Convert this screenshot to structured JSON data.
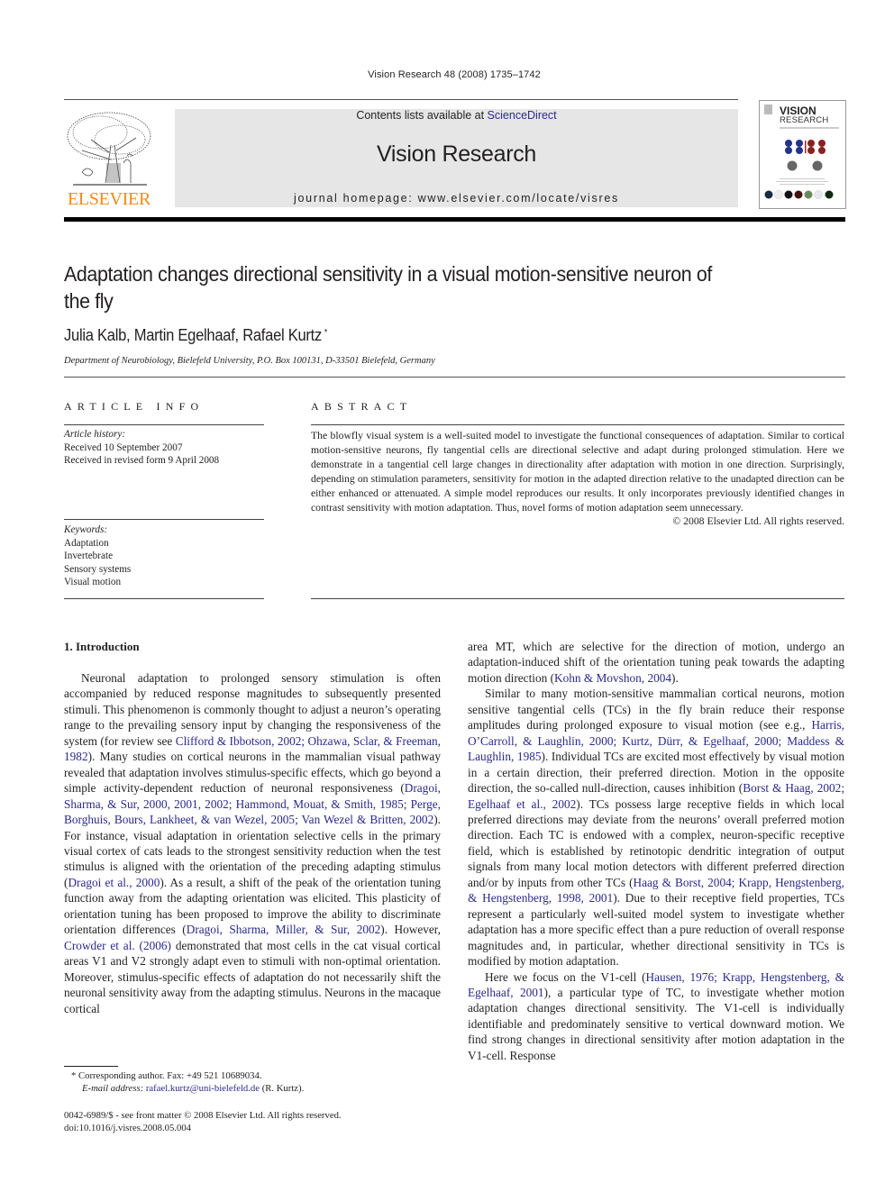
{
  "running_head": "Vision Research 48 (2008) 1735–1742",
  "masthead": {
    "contents_prefix": "Contents lists available at ",
    "contents_link": "ScienceDirect",
    "journal_title": "Vision Research",
    "homepage": "journal homepage: www.elsevier.com/locate/visres",
    "publisher_logo": "ELSEVIER",
    "cover_title_1": "VISION",
    "cover_title_2": "RESEARCH",
    "accent_color": "#f28a1a",
    "link_color": "#2a2a8c"
  },
  "article": {
    "title": "Adaptation changes directional sensitivity in a visual motion-sensitive neuron of the fly",
    "authors": "Julia Kalb, Martin Egelhaaf, Rafael Kurtz",
    "corresponding_mark": "*",
    "affiliation": "Department of Neurobiology, Bielefeld University, P.O. Box 100131, D-33501 Bielefeld, Germany"
  },
  "article_info": {
    "heading": "ARTICLE INFO",
    "history_label": "Article history:",
    "history": [
      "Received 10 September 2007",
      "Received in revised form 9 April 2008"
    ],
    "keywords_label": "Keywords:",
    "keywords": [
      "Adaptation",
      "Invertebrate",
      "Sensory systems",
      "Visual motion"
    ]
  },
  "abstract": {
    "heading": "ABSTRACT",
    "text": "The blowfly visual system is a well-suited model to investigate the functional consequences of adaptation. Similar to cortical motion-sensitive neurons, fly tangential cells are directional selective and adapt during prolonged stimulation. Here we demonstrate in a tangential cell large changes in directionality after adaptation with motion in one direction. Surprisingly, depending on stimulation parameters, sensitivity for motion in the adapted direction relative to the unadapted direction can be either enhanced or attenuated. A simple model reproduces our results. It only incorporates previously identified changes in contrast sensitivity with motion adaptation. Thus, novel forms of motion adaptation seem unnecessary.",
    "copyright": "© 2008 Elsevier Ltd. All rights reserved."
  },
  "body": {
    "section_heading": "1. Introduction",
    "p1": [
      {
        "t": "Neuronal adaptation to prolonged sensory stimulation is often accompanied by reduced response magnitudes to subsequently presented stimuli. This phenomenon is commonly thought to adjust a neuron’s operating range to the prevailing sensory input by changing the responsiveness of the system (for review see "
      },
      {
        "l": "Clifford & Ibbotson, 2002; Ohzawa, Sclar, & Freeman, 1982"
      },
      {
        "t": "). Many studies on cortical neurons in the mammalian visual pathway revealed that adaptation involves stimulus-specific effects, which go beyond a simple activity-dependent reduction of neuronal responsiveness ("
      },
      {
        "l": "Dragoi, Sharma, & Sur, 2000, 2001, 2002; Hammond, Mouat, & Smith, 1985; Perge, Borghuis, Bours, Lankheet, & van Wezel, 2005; Van Wezel & Britten, 2002"
      },
      {
        "t": "). For instance, visual adaptation in orientation selective cells in the primary visual cortex of cats leads to the strongest sensitivity reduction when the test stimulus is aligned with the orientation of the preceding adapting stimulus ("
      },
      {
        "l": "Dragoi et al., 2000"
      },
      {
        "t": "). As a result, a shift of the peak of the orientation tuning function away from the adapting orientation was elicited. This plasticity of orientation tuning has been proposed to improve the ability to discriminate orientation differences ("
      },
      {
        "l": "Dragoi, Sharma, Miller, & Sur, 2002"
      },
      {
        "t": "). However, "
      },
      {
        "l": "Crowder et al. (2006)"
      },
      {
        "t": " demonstrated that most cells in the cat visual cortical areas V1 and V2 strongly adapt even to stimuli with non-optimal orientation. Moreover, stimulus-specific effects of adaptation do not necessarily shift the neuronal sensitivity away from the adapting stimulus. Neurons in the macaque cortical area MT, which are selective for the direction of motion, undergo an adaptation-induced shift of the orientation tuning peak towards the adapting motion direction ("
      },
      {
        "l": "Kohn & Movshon, 2004"
      },
      {
        "t": ")."
      }
    ],
    "p2": [
      {
        "t": "Similar to many motion-sensitive mammalian cortical neurons, motion sensitive tangential cells (TCs) in the fly brain reduce their response amplitudes during prolonged exposure to visual motion (see e.g., "
      },
      {
        "l": "Harris, O’Carroll, & Laughlin, 2000; Kurtz, Dürr, & Egelhaaf, 2000; Maddess & Laughlin, 1985"
      },
      {
        "t": "). Individual TCs are excited most effectively by visual motion in a certain direction, their preferred direction. Motion in the opposite direction, the so-called null-direction, causes inhibition ("
      },
      {
        "l": "Borst & Haag, 2002; Egelhaaf et al., 2002"
      },
      {
        "t": "). TCs possess large receptive fields in which local preferred directions may deviate from the neurons’ overall preferred motion direction. Each TC is endowed with a complex, neuron-specific receptive field, which is established by retinotopic dendritic integration of output signals from many local motion detectors with different preferred direction and/or by inputs from other TCs ("
      },
      {
        "l": "Haag & Borst, 2004; Krapp, Hengstenberg, & Hengstenberg, 1998, 2001"
      },
      {
        "t": "). Due to their receptive field properties, TCs represent a particularly well-suited model system to investigate whether adaptation has a more specific effect than a pure reduction of overall response magnitudes and, in particular, whether directional sensitivity in TCs is modified by motion adaptation."
      }
    ],
    "p3": [
      {
        "t": "Here we focus on the V1-cell ("
      },
      {
        "l": "Hausen, 1976; Krapp, Hengstenberg, & Egelhaaf, 2001"
      },
      {
        "t": "), a particular type of TC, to investigate whether motion adaptation changes directional sensitivity. The V1-cell is individually identifiable and predominately sensitive to vertical downward motion. We find strong changes in directional sensitivity after motion adaptation in the V1-cell. Response"
      }
    ]
  },
  "footnote": {
    "mark": "*",
    "corresponding": "Corresponding author. Fax: +49 521 10689034.",
    "email_label": "E-mail address:",
    "email": "rafael.kurtz@uni-bielefeld.de",
    "email_suffix": " (R. Kurtz)."
  },
  "front_matter": {
    "issn_line": "0042-6989/$ - see front matter © 2008 Elsevier Ltd. All rights reserved.",
    "doi": "doi:10.1016/j.visres.2008.05.004"
  }
}
